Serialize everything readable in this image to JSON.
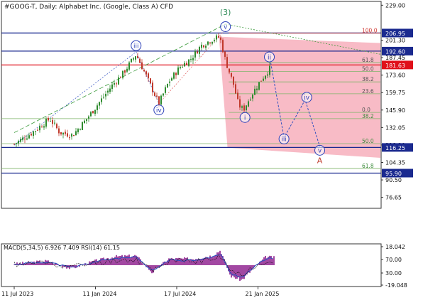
{
  "header": {
    "symbol_line": "#GOOG-T, Daily:  Alphabet Inc. (Google, Class A) CFD"
  },
  "chart_data": {
    "type": "candlestick",
    "title": "#GOOG-T, Daily:  Alphabet Inc. (Google, Class A) CFD",
    "price_axis": {
      "ylim": [
        68.0,
        232.0
      ],
      "tick_labels": [
        "229.00",
        "201.30",
        "187.45",
        "173.60",
        "159.75",
        "145.90",
        "132.05",
        "118.20",
        "104.35",
        "90.50",
        "76.65"
      ],
      "tick_values": [
        229.0,
        201.3,
        187.45,
        173.6,
        159.75,
        145.9,
        132.05,
        118.2,
        104.35,
        90.5,
        76.65
      ]
    },
    "time_axis": {
      "labels": [
        "11 Jul 2023",
        "11 Jan 2024",
        "17 Jul 2024",
        "21 Jan 2025"
      ],
      "positions": [
        0.0,
        0.5,
        1.0,
        1.5
      ]
    },
    "price_lines": [
      {
        "label": "206.95",
        "value": 206.95,
        "color": "#1b2a8f"
      },
      {
        "label": "192.60",
        "value": 192.6,
        "color": "#1b2a8f"
      },
      {
        "label": "181.63",
        "value": 181.63,
        "color": "#e0101a"
      },
      {
        "label": "116.25",
        "value": 116.25,
        "color": "#1b2a8f"
      },
      {
        "label": "95.90",
        "value": 95.9,
        "color": "#1b2a8f"
      }
    ],
    "fib_levels_upper": [
      {
        "label": "100.0",
        "value": 206.95
      },
      {
        "label": "61.8",
        "value": 183.5
      },
      {
        "label": "50.0",
        "value": 176.4
      },
      {
        "label": "38.2",
        "value": 168.2
      },
      {
        "label": "23.6",
        "value": 158.8
      },
      {
        "label": "0.0",
        "value": 144.0
      }
    ],
    "fib_levels_lower": [
      {
        "label": "38.2",
        "value": 139.1
      },
      {
        "label": "50.0",
        "value": 119.3
      },
      {
        "label": "61.8",
        "value": 99.6
      }
    ],
    "price_series_anchors": [
      {
        "t": 0.0,
        "p": 119
      },
      {
        "t": 0.1,
        "p": 127
      },
      {
        "t": 0.22,
        "p": 139
      },
      {
        "t": 0.28,
        "p": 128
      },
      {
        "t": 0.36,
        "p": 126
      },
      {
        "t": 0.44,
        "p": 138
      },
      {
        "t": 0.5,
        "p": 148
      },
      {
        "t": 0.6,
        "p": 165
      },
      {
        "t": 0.67,
        "p": 175
      },
      {
        "t": 0.75,
        "p": 190
      },
      {
        "t": 0.83,
        "p": 168
      },
      {
        "t": 0.89,
        "p": 151
      },
      {
        "t": 0.95,
        "p": 168
      },
      {
        "t": 1.02,
        "p": 180
      },
      {
        "t": 1.09,
        "p": 187
      },
      {
        "t": 1.15,
        "p": 197
      },
      {
        "t": 1.22,
        "p": 202
      },
      {
        "t": 1.265,
        "p": 204
      },
      {
        "t": 1.3,
        "p": 185
      },
      {
        "t": 1.35,
        "p": 166
      },
      {
        "t": 1.38,
        "p": 150
      },
      {
        "t": 1.41,
        "p": 146
      },
      {
        "t": 1.46,
        "p": 158
      },
      {
        "t": 1.52,
        "p": 170
      },
      {
        "t": 1.58,
        "p": 180
      }
    ],
    "wave_labels": [
      {
        "text": "(3)",
        "t": 1.3,
        "p": 223.5,
        "color": "#2e8b57",
        "circled": false
      },
      {
        "text": "v",
        "t": 1.3,
        "p": 212,
        "color": "#2b3fb8",
        "circled": true
      },
      {
        "text": "iii",
        "t": 0.75,
        "p": 197,
        "color": "#2b3fb8",
        "circled": true
      },
      {
        "text": "iv",
        "t": 0.89,
        "p": 146,
        "color": "#2b3fb8",
        "circled": true
      },
      {
        "text": "ii",
        "t": 1.57,
        "p": 188,
        "color": "#2b3fb8",
        "circled": true
      },
      {
        "text": "i",
        "t": 1.42,
        "p": 140,
        "color": "#2b3fb8",
        "circled": true
      },
      {
        "text": "iii",
        "t": 1.66,
        "p": 123,
        "color": "#2b3fb8",
        "circled": true
      },
      {
        "text": "iv",
        "t": 1.8,
        "p": 156,
        "color": "#2b3fb8",
        "circled": true
      },
      {
        "text": "v",
        "t": 1.88,
        "p": 114,
        "color": "#2b3fb8",
        "circled": true
      },
      {
        "text": "A",
        "t": 1.88,
        "p": 106,
        "color": "#c0392b",
        "circled": false
      }
    ],
    "projection_path": [
      {
        "t": 1.575,
        "p": 186
      },
      {
        "t": 1.66,
        "p": 124
      },
      {
        "t": 1.79,
        "p": 154
      },
      {
        "t": 1.885,
        "p": 115
      }
    ],
    "indicator": {
      "label": "MACD(5,34,5) 6.926 7.409 RSI(14) 61.15",
      "macd_axis": {
        "labels": [
          "18.042",
          "70.00",
          "30.00",
          "-19.048"
        ],
        "values": [
          18.042,
          70.0,
          30.0,
          -19.048
        ]
      },
      "histogram_anchors": [
        {
          "t": 0.0,
          "v": 1
        },
        {
          "t": 0.2,
          "v": 4
        },
        {
          "t": 0.35,
          "v": -3
        },
        {
          "t": 0.5,
          "v": 4
        },
        {
          "t": 0.62,
          "v": 8
        },
        {
          "t": 0.75,
          "v": 9
        },
        {
          "t": 0.85,
          "v": -7
        },
        {
          "t": 0.95,
          "v": 6
        },
        {
          "t": 1.1,
          "v": 6
        },
        {
          "t": 1.22,
          "v": 9
        },
        {
          "t": 1.27,
          "v": 14
        },
        {
          "t": 1.33,
          "v": -10
        },
        {
          "t": 1.4,
          "v": -14
        },
        {
          "t": 1.48,
          "v": -2
        },
        {
          "t": 1.55,
          "v": 8
        },
        {
          "t": 1.6,
          "v": 7
        }
      ]
    }
  },
  "colors": {
    "up": "#2e8b2e",
    "down": "#c0392b",
    "zone_fill": "#f6aab8",
    "fib": "#7fb46a",
    "wave_blue": "#2b3fb8",
    "wave_green": "#2e8b57",
    "trend_green": "#3a9a3a",
    "trend_red": "#e06060",
    "macd_hist": "#8b1a8b",
    "rsi": "#2050c0"
  }
}
